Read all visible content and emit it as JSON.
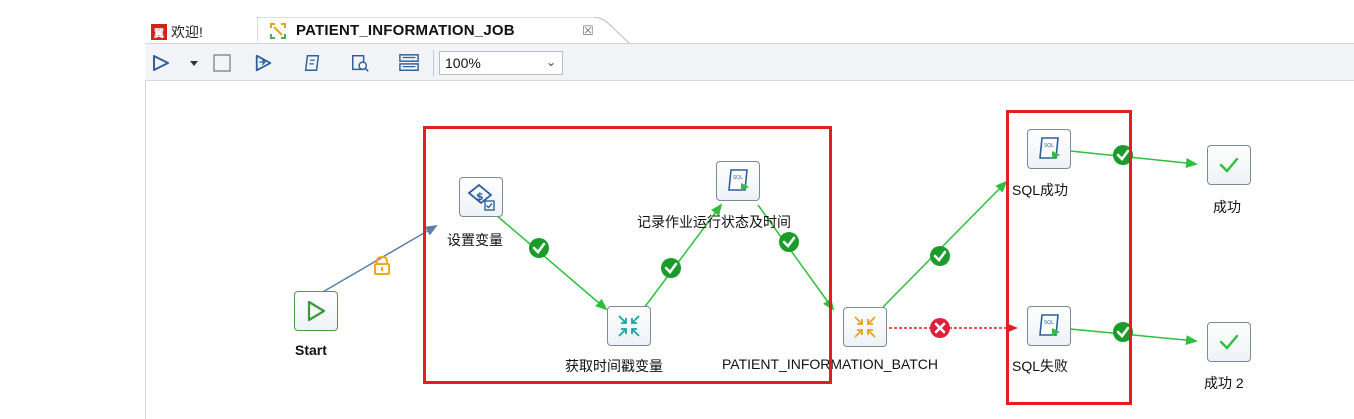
{
  "tabs": {
    "welcome": {
      "label": "欢迎!",
      "icon": "welcome-logo-icon"
    },
    "job": {
      "label": "PATIENT_INFORMATION_JOB",
      "icon": "job-icon",
      "close": "☒"
    }
  },
  "toolbar": {
    "buttons": [
      "run-icon",
      "run-dropdown-icon",
      "stop-icon",
      "run-last-icon",
      "script-icon",
      "search-log-icon",
      "layout-icon"
    ],
    "zoom": "100%"
  },
  "nodes": {
    "start": "Start",
    "set_var": "设置变量",
    "get_ts": "获取时间戳变量",
    "log_status": "记录作业运行状态及时间",
    "batch": "PATIENT_INFORMATION_BATCH",
    "sql_ok": "SQL成功",
    "sql_fail": "SQL失败",
    "success1": "成功",
    "success2": "成功 2"
  },
  "colors": {
    "success_hop": "#2fbf3a",
    "error_hop": "#e02020",
    "unconditional_hop": "#5a7fa8",
    "highlight_box": "#e41e1e",
    "lock": "#f3a91b"
  }
}
